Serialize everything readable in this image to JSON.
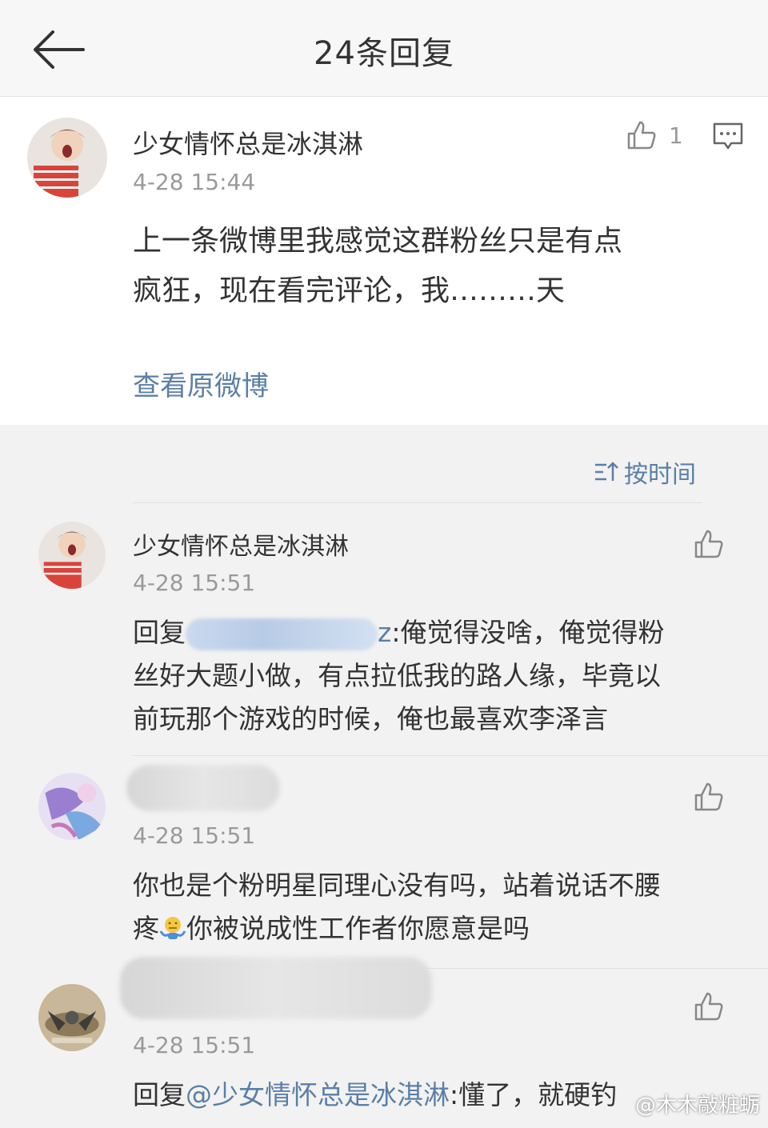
{
  "header": {
    "title": "24条回复"
  },
  "main_comment": {
    "username": "少女情怀总是冰淇淋",
    "time": "4-28 15:44",
    "like_count": "1",
    "text_line1": "上一条微博里我感觉这群粉丝只是有点",
    "text_line2": "疯狂，现在看完评论，我………天",
    "view_original": "查看原微博"
  },
  "sort": {
    "label": "按时间"
  },
  "replies": [
    {
      "username": "少女情怀总是冰淇淋",
      "time": "4-28 15:51",
      "prefix": "回复",
      "mention_tail": "z",
      "line1": ":俺觉得没啥，俺觉得粉",
      "line2": "丝好大题小做，有点拉低我的路人缘，毕竟以",
      "line3": "前玩那个游戏的时候，俺也最喜欢李泽言"
    },
    {
      "time": "4-28 15:51",
      "line1": "你也是个粉明星同理心没有吗，站着说话不腰",
      "line2a": "疼",
      "line2b": "你被说成性工作者你愿意是吗"
    },
    {
      "time": "4-28 15:51",
      "prefix": "回复",
      "mention": "@少女情怀总是冰淇淋",
      "line1": ":懂了，就硬钓"
    }
  ],
  "watermark": "@木木敲粧蛎",
  "colors": {
    "link": "#5b7fa6",
    "text": "#333333",
    "muted": "#9a9a9a",
    "background": "#f2f2f2"
  }
}
